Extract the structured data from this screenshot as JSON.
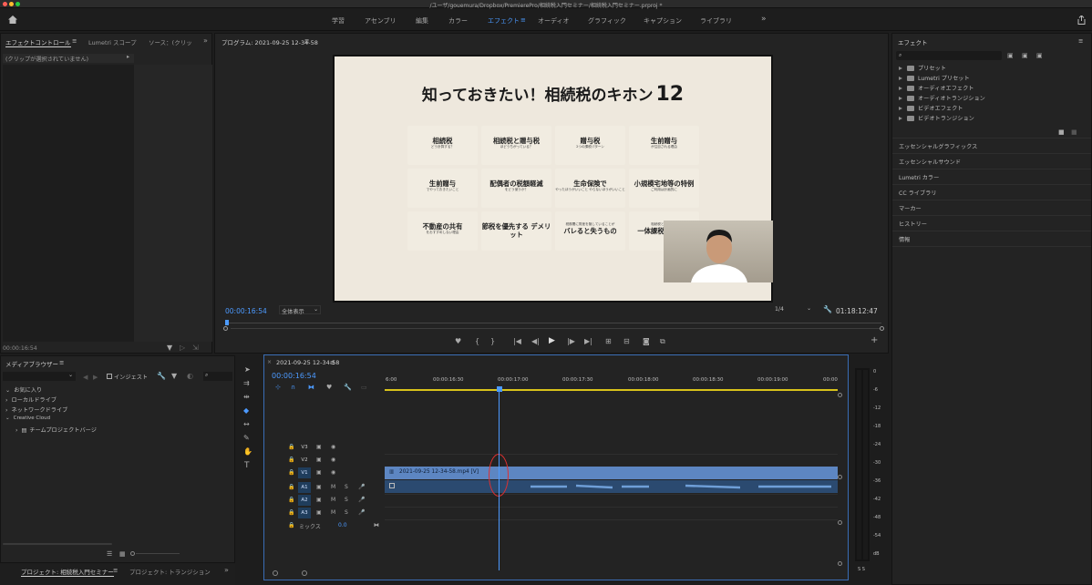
{
  "window": {
    "title": "/ユーザ/gouemura/Dropbox/PremierePro/相続税入門セミナー/相続税入門セミナー.prproj *"
  },
  "workspaces": {
    "items": [
      "学習",
      "アセンブリ",
      "編集",
      "カラー",
      "エフェクト",
      "オーディオ",
      "グラフィック",
      "キャプション",
      "ライブラリ"
    ],
    "active": "エフェクト",
    "more": "»"
  },
  "effect_controls": {
    "tabs": [
      "エフェクトコントロール",
      "Lumetri スコープ",
      "ソース：(クリッ"
    ],
    "no_clip": "(クリップが選択されていません)",
    "timecode": "00:00:16:54"
  },
  "program": {
    "title": "プログラム: 2021-09-25 12-34-58",
    "current_time": "00:00:16:54",
    "fit": "全体表示",
    "resolution": "1/4",
    "duration": "01:18:12:47",
    "playhead_fraction": 0.0
  },
  "slide": {
    "heading": "知っておきたい！相続税のキホン",
    "heading_number": "12",
    "cards": [
      {
        "title": "相続税",
        "sub": "どう計算する？"
      },
      {
        "title": "相続税と贈与税",
        "sub": "ほどうちがっている？"
      },
      {
        "title": "贈与税",
        "sub": "2つの課税パターン"
      },
      {
        "title": "生前贈与",
        "sub": "が注目される理由"
      },
      {
        "title": "生前贈与",
        "sub": "でやっておきたいこと"
      },
      {
        "title": "配偶者の税額軽減",
        "sub": "をどう使うか？"
      },
      {
        "title": "生命保険で",
        "sub": "やったほうがいいこと やらないほうがいいこと"
      },
      {
        "title": "小規模宅地等の特例",
        "sub": "ご利用は計画的に"
      },
      {
        "title": "不動産の共有",
        "sub": "をおすすめしない理由"
      },
      {
        "title": "節税を優先する デメリット",
        "sub": ""
      },
      {
        "title": "バレると失うもの",
        "sub": "税務署に財産を隠していることが"
      },
      {
        "title": "一体課税の方向性",
        "sub": "相続税と贈与税の"
      }
    ]
  },
  "effects_panel": {
    "title": "エフェクト",
    "search_placeholder": "",
    "tree": [
      "プリセット",
      "Lumetri プリセット",
      "オーディオエフェクト",
      "オーディオトランジション",
      "ビデオエフェクト",
      "ビデオトランジション"
    ],
    "sections": [
      "エッセンシャルグラフィックス",
      "エッセンシャルサウンド",
      "Lumetri カラー",
      "CC ライブラリ",
      "マーカー",
      "ヒストリー",
      "情報"
    ]
  },
  "media_browser": {
    "title": "メディアブラウザー",
    "ingest_label": "インジェスト",
    "tree": [
      "お気に入り",
      "ローカルドライブ",
      "ネットワークドライブ",
      "Creative Cloud",
      "チームプロジェクトバージ"
    ],
    "bottom_tabs": [
      "プロジェクト: 相続税入門セミナー",
      "プロジェクト: トランジション"
    ]
  },
  "timeline": {
    "tab": "2021-09-25 12-34-58",
    "current_time": "00:00:16:54",
    "ruler": [
      "6:00",
      "00:00:16:30",
      "00:00:17:00",
      "00:00:17:30",
      "00:00:18:00",
      "00:00:18:30",
      "00:00:19:00",
      "00:00"
    ],
    "video_tracks": [
      "V3",
      "V2",
      "V1"
    ],
    "audio_tracks": [
      "A1",
      "A2",
      "A3"
    ],
    "mix_label": "ミックス",
    "mix_value": "0.0",
    "clip_name": "2021-09-25 12-34-58.mp4 [V]",
    "mute": "M",
    "solo": "S"
  },
  "meter": {
    "labels": [
      "0",
      "-6",
      "-12",
      "-18",
      "-24",
      "-30",
      "-36",
      "-42",
      "-48",
      "-54",
      "dB"
    ],
    "bottom": "S S"
  },
  "colors": {
    "accent": "#4c9aff",
    "clip": "#5d86c2",
    "marker": "#e03030",
    "playhead": "#4c9aff"
  }
}
